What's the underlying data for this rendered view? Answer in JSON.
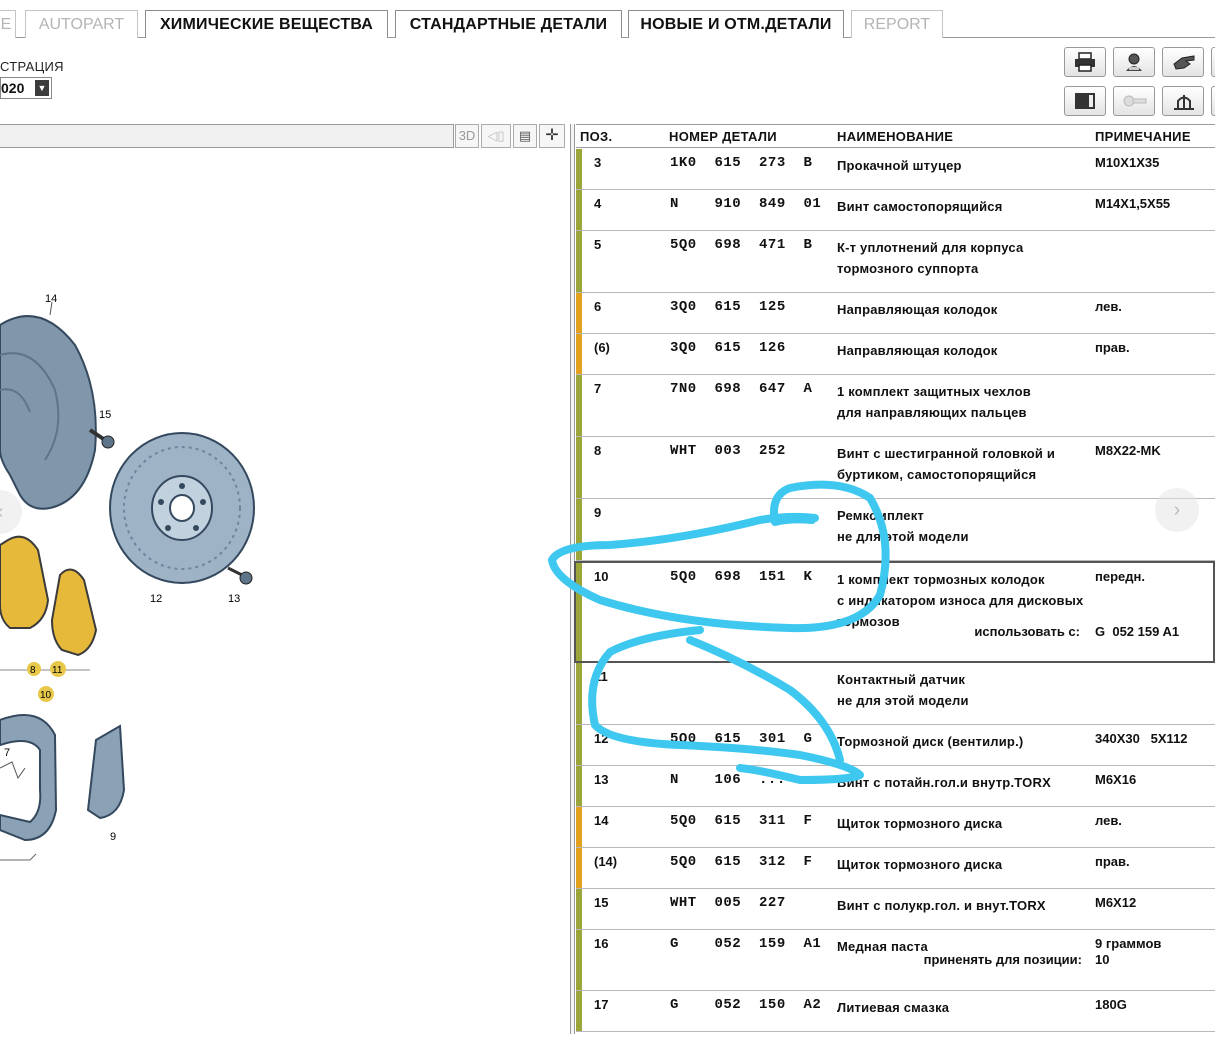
{
  "tabs": [
    {
      "label": "E",
      "state": "disabled"
    },
    {
      "label": "AUTOPART",
      "state": "disabled"
    },
    {
      "label": "ХИМИЧЕСКИЕ ВЕЩЕСТВА",
      "state": "active"
    },
    {
      "label": "СТАНДАРТНЫЕ ДЕТАЛИ",
      "state": "active"
    },
    {
      "label": "НОВЫЕ И ОТМ.ДЕТАЛИ",
      "state": "active"
    },
    {
      "label": "REPORT",
      "state": "disabled"
    }
  ],
  "illustration": {
    "label": "СТРАЦИЯ",
    "selected": "020",
    "view_buttons": [
      "3D",
      "◁▯",
      "▤",
      "✛"
    ],
    "callouts": [
      "14",
      "15",
      "12",
      "13",
      "8",
      "11",
      "10",
      "7",
      "9"
    ]
  },
  "toolbar_icons": [
    "print-icon",
    "user-search-icon",
    "hand-point-icon",
    "document-icon",
    "key-icon",
    "scale-icon"
  ],
  "table": {
    "headers": {
      "pos": "ПОЗ.",
      "part_number": "НОМЕР ДЕТАЛИ",
      "name": "НАИМЕНОВАНИЕ",
      "note": "ПРИМЕЧАНИЕ"
    },
    "rows": [
      {
        "pos": "3",
        "number": "1K0  615  273  B",
        "name": "Прокачной штуцер",
        "note": "M10X1X35",
        "stripe": "green"
      },
      {
        "pos": "4",
        "number": "N    910  849  01",
        "name": "Винт самостопорящийся",
        "note": "M14X1,5X55",
        "stripe": "green"
      },
      {
        "pos": "5",
        "number": "5Q0  698  471  B",
        "name": "К-т уплотнений для корпуса\nтормозного суппорта",
        "note": "",
        "stripe": "green"
      },
      {
        "pos": "6",
        "number": "3Q0  615  125",
        "name": "Направляющая колодок",
        "note": "лев.",
        "stripe": "orange"
      },
      {
        "pos": "(6)",
        "number": "3Q0  615  126",
        "name": "Направляющая колодок",
        "note": "прав.",
        "stripe": "orange"
      },
      {
        "pos": "7",
        "number": "7N0  698  647  A",
        "name": "1 комплект защитных чехлов\nдля направляющих пальцев",
        "note": "",
        "stripe": "green"
      },
      {
        "pos": "8",
        "number": "WHT  003  252",
        "name": "Винт с шестигранной головкой и\nбуртиком, самостопорящийся",
        "note": "M8X22-MK",
        "stripe": "green"
      },
      {
        "pos": "9",
        "number": "",
        "name": "Ремкомплект\nне для этой модели",
        "note": "",
        "stripe": "green"
      },
      {
        "pos": "10",
        "number": "5Q0  698  151  K",
        "name": "1 комплект тормозных колодок\nс индикатором износа для дисковых\nтормозов",
        "note": "передн.",
        "stripe": "green",
        "extra_label": "использовать с:",
        "extra_value": "G  052 159 A1"
      },
      {
        "pos": "11",
        "number": "",
        "name": "Контактный датчик\nне для этой модели",
        "note": "",
        "stripe": "green"
      },
      {
        "pos": "12",
        "number": "5Q0  615  301  G",
        "name": "Тормозной диск (вентилир.)",
        "note": "340X30   5X112",
        "stripe": "green"
      },
      {
        "pos": "13",
        "number": "N    106  ...  ..",
        "name": "Винт с потайн.гол.и внутр.TORX",
        "note": "M6X16",
        "stripe": "green"
      },
      {
        "pos": "14",
        "number": "5Q0  615  311  F",
        "name": "Щиток тормозного диска",
        "note": "лев.",
        "stripe": "orange"
      },
      {
        "pos": "(14)",
        "number": "5Q0  615  312  F",
        "name": "Щиток тормозного диска",
        "note": "прав.",
        "stripe": "orange"
      },
      {
        "pos": "15",
        "number": "WHT  005  227",
        "name": "Винт с полукр.гол. и внут.TORX",
        "note": "M6X12",
        "stripe": "green"
      },
      {
        "pos": "16",
        "number": "G    052  159  A1",
        "name": "Медная паста",
        "note": "9 граммов",
        "stripe": "green",
        "extra_label": "приненять для позиции:",
        "extra_value": "10"
      },
      {
        "pos": "17",
        "number": "G    052  150  A2",
        "name": "Литиевая смазка",
        "note": "180G",
        "stripe": "green"
      }
    ]
  },
  "colors": {
    "stripe_green": "#9aa63a",
    "stripe_orange": "#e3a11f",
    "scribble": "#3ec8f0"
  }
}
